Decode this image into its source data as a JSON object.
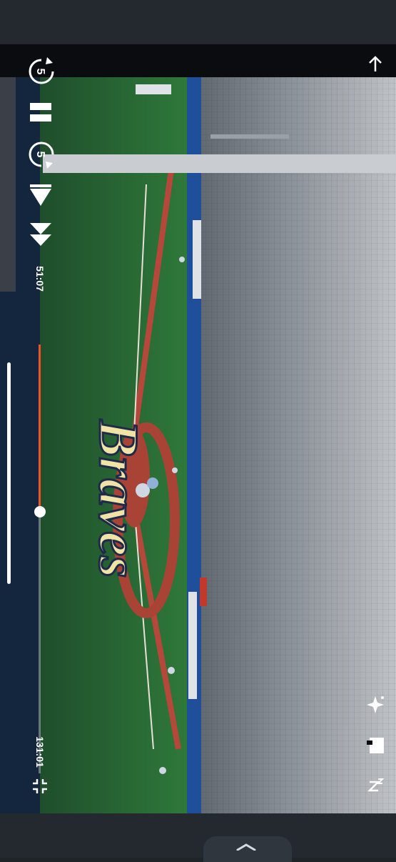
{
  "player": {
    "current_time": "51:07",
    "total_time": "131:01",
    "progress_fraction": 0.39,
    "volume_fraction": 1.0,
    "accent_color": "#f0522a"
  },
  "controls": {
    "rewind_seconds": "5",
    "forward_seconds": "5",
    "icons": [
      "rewind-5-icon",
      "pause-icon",
      "forward-5-icon",
      "skip-next-icon",
      "fast-forward-icon",
      "exit-fullscreen-icon",
      "back-arrow-icon",
      "sparkle-icon",
      "caption-icon",
      "sleep-icon"
    ]
  },
  "scene": {
    "field_logo_text": "Braves"
  }
}
